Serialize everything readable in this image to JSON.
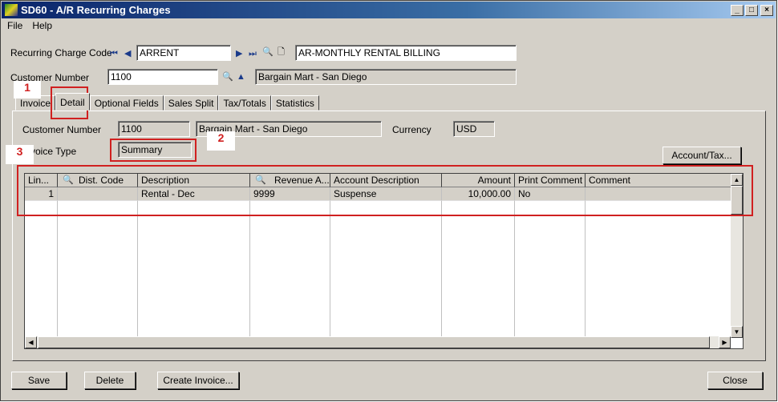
{
  "window": {
    "title": "SD60 - A/R Recurring Charges",
    "minimize": "_",
    "maximize": "□",
    "close": "×"
  },
  "menu": [
    "File",
    "Help"
  ],
  "header": {
    "code_label": "Recurring Charge Code",
    "code_value": "ARRENT",
    "code_desc": "AR-MONTHLY RENTAL BILLING",
    "cust_label": "Customer Number",
    "cust_value": "1100",
    "cust_name": "Bargain Mart - San Diego"
  },
  "tabs": [
    "Invoice",
    "Detail",
    "Optional Fields",
    "Sales Split",
    "Tax/Totals",
    "Statistics"
  ],
  "detail": {
    "cust_label": "Customer Number",
    "cust_value": "1100",
    "cust_name": "Bargain Mart - San Diego",
    "currency_label": "Currency",
    "currency_value": "USD",
    "invtype_label": "Invoice Type",
    "invtype_value": "Summary",
    "account_tax_button": "Account/Tax..."
  },
  "grid": {
    "columns": [
      "Lin...",
      "Dist. Code",
      "Description",
      "Revenue A...",
      "Account Description",
      "Amount",
      "Print Comment",
      "Comment"
    ],
    "rows": [
      [
        "1",
        "",
        "Rental - Dec",
        "9999",
        "Suspense",
        "10,000.00",
        "No",
        ""
      ]
    ]
  },
  "annotations": [
    "1",
    "2",
    "3"
  ],
  "footer": {
    "save": "Save",
    "delete": "Delete",
    "create_invoice": "Create Invoice...",
    "close": "Close"
  },
  "colors": {
    "annotation": "#d02020",
    "titlebar": "#0a246a"
  }
}
